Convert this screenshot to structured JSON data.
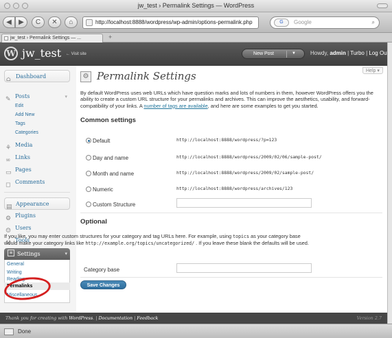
{
  "browser": {
    "window_title": "jw_test › Permalink Settings — WordPress",
    "url": "http://localhost:8888/wordpress/wp-admin/options-permalink.php",
    "search_placeholder": "Google",
    "search_engine_label": "G",
    "tab_label": "jw_test › Permalink Settings — ...",
    "new_tab": "+",
    "status_text": "Done",
    "buttons": {
      "back": "◀",
      "forward": "▶",
      "reload": "C",
      "stop": "✕",
      "home": "⌂"
    }
  },
  "header": {
    "logo": "W",
    "site_title": "jw_test",
    "visit_site": "← Visit site",
    "new_post": "New Post",
    "dropdown_arrow": "▼",
    "howdy_prefix": "Howdy, ",
    "user": "admin",
    "sep1": " | ",
    "turbo": "Turbo",
    "sep2": " | ",
    "logout": "Log Out"
  },
  "sidebar": {
    "dashboard": "Dashboard",
    "posts": "Posts",
    "posts_sub": [
      "Edit",
      "Add New",
      "Tags",
      "Categories"
    ],
    "media": "Media",
    "links": "Links",
    "pages": "Pages",
    "comments": "Comments",
    "appearance": "Appearance",
    "plugins": "Plugins",
    "users": "Users",
    "tools": "Tools",
    "settings": "Settings",
    "settings_sub": [
      "General",
      "Writing",
      "Reading",
      "Permalinks",
      "Miscellaneous"
    ]
  },
  "main": {
    "help": "Help ▾",
    "title": "Permalink Settings",
    "intro_before_link": "By default WordPress uses web URLs which have question marks and lots of numbers in them, however WordPress offers you the ability to create a custom URL structure for your permalinks and archives. This can improve the aesthetics, usability, and forward-compatibility of your links. A ",
    "intro_link": "number of tags are available",
    "intro_after_link": ", and here are some examples to get you started.",
    "common_heading": "Common settings",
    "options": [
      {
        "label": "Default",
        "example": "http://localhost:8888/wordpress/?p=123",
        "selected": true
      },
      {
        "label": "Day and name",
        "example": "http://localhost:8888/wordpress/2009/02/06/sample-post/",
        "selected": false
      },
      {
        "label": "Month and name",
        "example": "http://localhost:8888/wordpress/2009/02/sample-post/",
        "selected": false
      },
      {
        "label": "Numeric",
        "example": "http://localhost:8888/wordpress/archives/123",
        "selected": false
      },
      {
        "label": "Custom Structure",
        "example": "",
        "selected": false
      }
    ],
    "optional_heading": "Optional",
    "optional_text_1": "If you like, you may enter custom structures for your category and tag URLs here. For example, using ",
    "optional_code_1": "topics",
    "optional_text_2": " as your category base would make your category links like ",
    "optional_code_2": "http://example.org/topics/uncategorized/",
    "optional_text_3": " . If you leave these blank the defaults will be used.",
    "category_base_label": "Category base",
    "category_base_value": "",
    "save_button": "Save Changes"
  },
  "footer": {
    "thanks_prefix": "Thank you for creating with ",
    "wordpress": "WordPress",
    "sep1": ". | ",
    "documentation": "Documentation",
    "sep2": " | ",
    "feedback": "Feedback",
    "version": "Version 2.7"
  },
  "colors": {
    "link_blue": "#2a6e9c",
    "annotation_red": "#d42020",
    "header_dark": "#464646"
  }
}
